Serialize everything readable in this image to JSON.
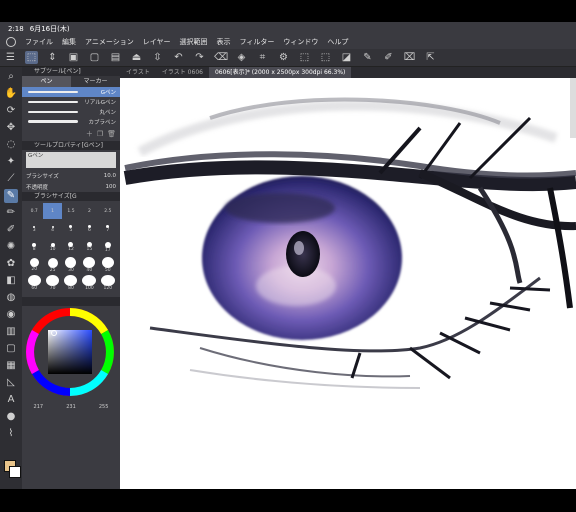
{
  "status": {
    "time": "2:18",
    "date": "6月16日(木)"
  },
  "menu": [
    "ファイル",
    "編集",
    "アニメーション",
    "レイヤー",
    "選択範囲",
    "表示",
    "フィルター",
    "ウィンドウ",
    "ヘルプ"
  ],
  "tabs": [
    {
      "label": "イラスト",
      "active": false
    },
    {
      "label": "イラスト 0606",
      "active": false
    },
    {
      "label": "0606[表示]* (2000 x 2500px 300dpi 66.3%)",
      "active": true
    }
  ],
  "subtool": {
    "header": "サブツール[ペン]",
    "tabs": [
      "ペン",
      "マーカー"
    ],
    "items": [
      {
        "label": "Gペン",
        "selected": true
      },
      {
        "label": "リアルGペン",
        "selected": false
      },
      {
        "label": "丸ペン",
        "selected": false
      },
      {
        "label": "カブラペン",
        "selected": false
      }
    ]
  },
  "tool_property": {
    "header": "ツールプロパティ[Gペン]",
    "name": "Gペン",
    "brush_size_label": "ブラシサイズ",
    "brush_size_value": "10.0",
    "opacity_label": "不透明度",
    "opacity_value": "100"
  },
  "brush_size_panel": {
    "header": "ブラシサイズ[G",
    "sizes": [
      "0.7",
      "1",
      "1.5",
      "2",
      "2.5",
      "3",
      "4",
      "5",
      "6",
      "7",
      "8",
      "10",
      "12",
      "15",
      "17",
      "20",
      "25",
      "30",
      "40",
      "50",
      "60",
      "70",
      "80",
      "100",
      "120"
    ]
  },
  "color": {
    "hue_ring": "hsv",
    "current": "#e8c48a",
    "rgb": [
      "217",
      "231",
      "255"
    ]
  }
}
